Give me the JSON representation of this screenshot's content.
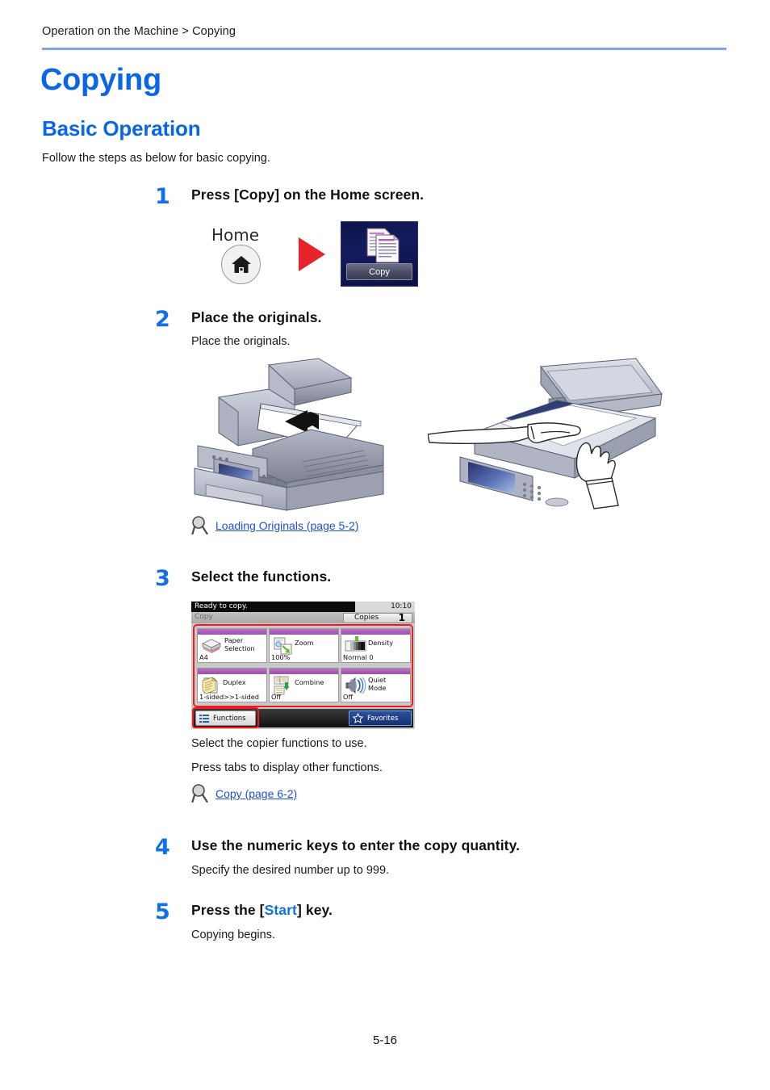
{
  "header": {
    "breadcrumb": "Operation on the Machine > Copying",
    "rule_color": "#7fa3e8"
  },
  "titles": {
    "h1": "Copying",
    "h2": "Basic Operation",
    "title_color": "#0a66e8",
    "intro": "Follow the steps as below for basic copying."
  },
  "steps": [
    {
      "number": "1",
      "heading": "Press [Copy] on the Home screen.",
      "body": ""
    },
    {
      "number": "2",
      "heading": "Place the originals.",
      "body": "Place the originals."
    },
    {
      "number": "3",
      "heading": "Select the functions.",
      "body1": "Select the copier functions to use.",
      "body2": "Press tabs to display other functions."
    },
    {
      "number": "4",
      "heading": "Use the numeric keys to enter the copy quantity.",
      "body": "Specify the desired number up to 999."
    },
    {
      "number": "5",
      "heading_pre": "Press the [",
      "heading_key": "Start",
      "heading_post": "] key.",
      "body": "Copying begins."
    }
  ],
  "step1_graphic": {
    "home_label": "Home",
    "home_icon": "house-icon",
    "arrow_icon": "right-arrow-icon",
    "arrow_color": "#e8222a",
    "copy_tile_label": "Copy",
    "copy_tile_icon": "copy-pages-icon"
  },
  "step2_graphic": {
    "left_illustration": "mfp-document-feeder-illustration",
    "right_illustration": "mfp-platen-glass-hands-illustration"
  },
  "xrefs": {
    "loading_originals": "Loading Originals (page 5-2)",
    "copy_reference": "Copy (page 6-2)",
    "icon": "magnifier-icon",
    "link_color": "#1f4fd8"
  },
  "touch_panel": {
    "status_message": "Ready to copy.",
    "clock": "10:10",
    "mode_label": "Copy",
    "copies_label": "Copies",
    "copies_value": "1",
    "highlight_color": "#ee1b22",
    "tile_bar_color": "#9b4fae",
    "tiles": [
      {
        "label": "Paper\nSelection",
        "value": "A4",
        "icon": "paper-stack-icon"
      },
      {
        "label": "Zoom",
        "value": "100%",
        "icon": "zoom-page-icon"
      },
      {
        "label": "Density",
        "value": "Normal 0",
        "icon": "density-gradient-icon"
      },
      {
        "label": "Duplex",
        "value": "1-sided>>1-sided",
        "icon": "duplex-icon"
      },
      {
        "label": "Combine",
        "value": "Off",
        "icon": "combine-icon"
      },
      {
        "label": "Quiet\nMode",
        "value": "Off",
        "icon": "speaker-quiet-icon"
      }
    ],
    "functions_button": "Functions",
    "functions_icon": "list-icon",
    "favorites_button": "Favorites",
    "favorites_icon": "star-icon"
  },
  "footer": {
    "page_number": "5-16"
  }
}
